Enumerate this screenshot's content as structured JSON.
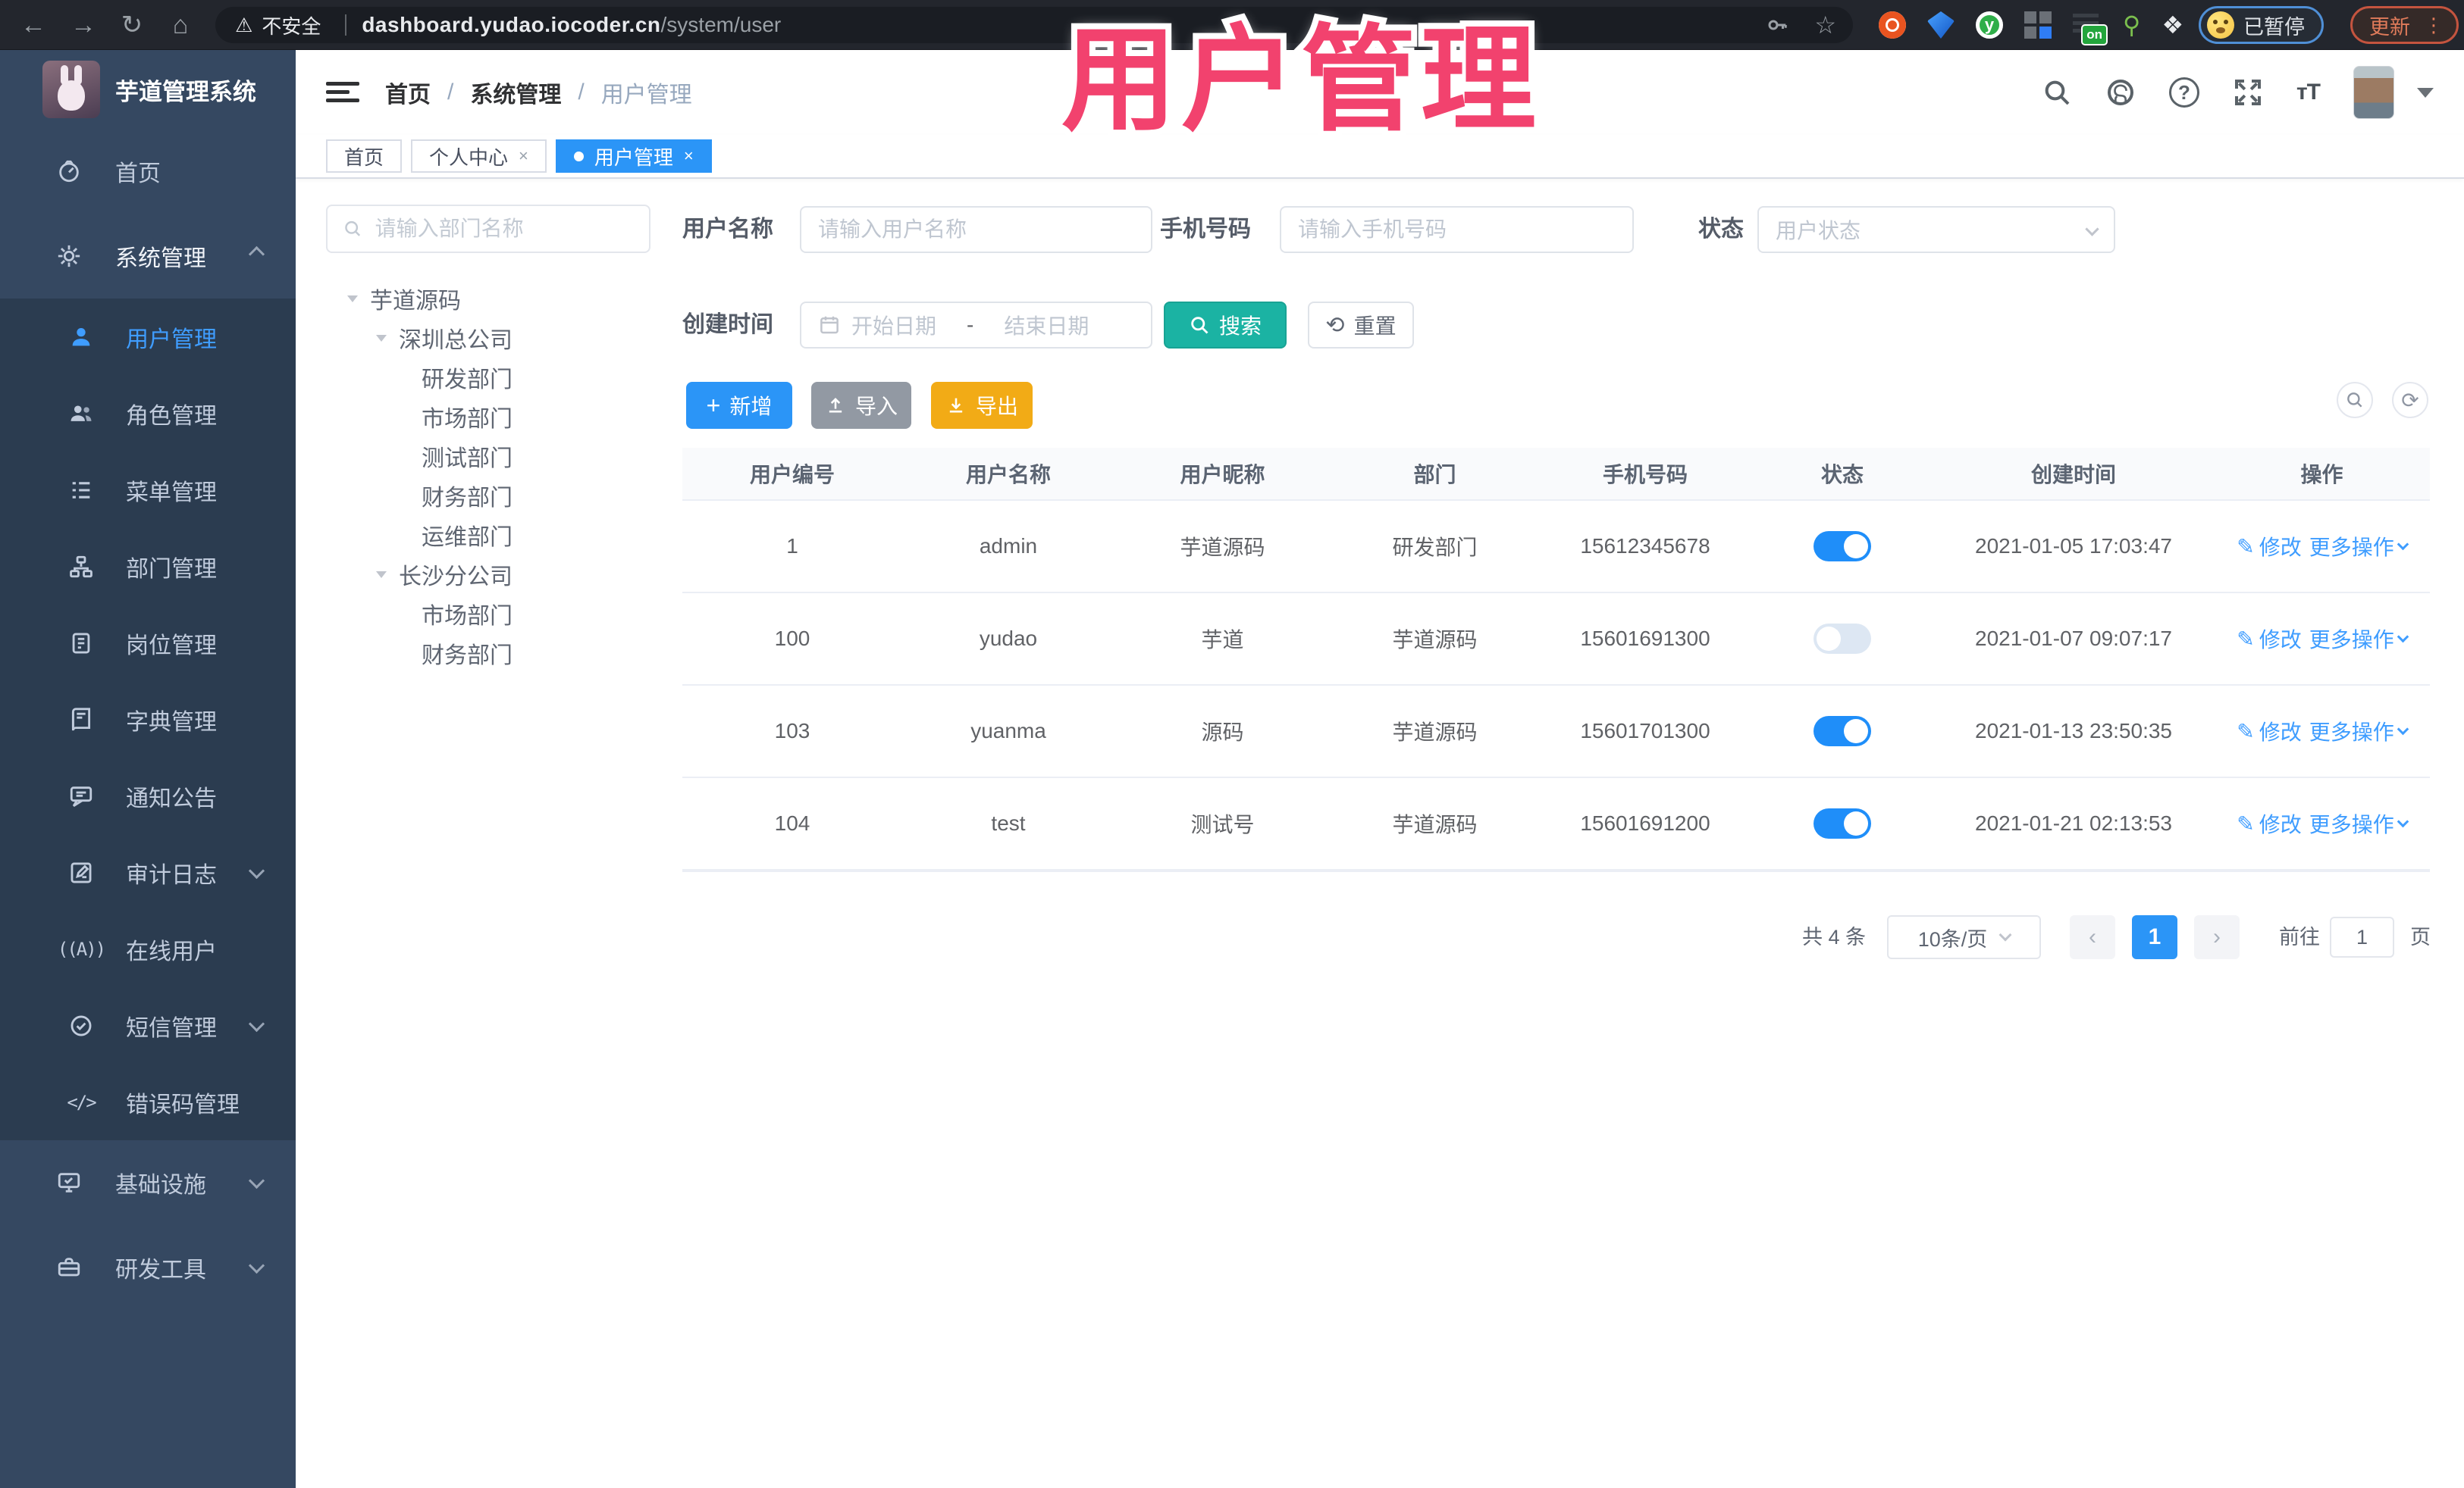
{
  "colors": {
    "accent": "#2b95f7",
    "teal_search": "#1bb3a3",
    "export_yellow": "#f2ab16",
    "import_gray": "#9299a3",
    "sidebar_bg": "#354861",
    "submenu_bg": "#2b3c50",
    "overlay_pink": "#f2426e",
    "toggle_on": "#1f8ef9"
  },
  "overlay_title": "用户管理",
  "browser": {
    "security_warning": "不安全",
    "url_host": "dashboard.yudao.iocoder.cn",
    "url_path": "/system/user",
    "ext_green_letter": "y",
    "ext_badge": "on",
    "profile_badge": "已暂停",
    "update_button": "更新",
    "menu_dots": "⋮"
  },
  "sidebar": {
    "app_title": "芋道管理系统",
    "items": [
      {
        "label": "首页"
      },
      {
        "label": "系统管理"
      },
      {
        "label": "用户管理"
      },
      {
        "label": "角色管理"
      },
      {
        "label": "菜单管理"
      },
      {
        "label": "部门管理"
      },
      {
        "label": "岗位管理"
      },
      {
        "label": "字典管理"
      },
      {
        "label": "通知公告"
      },
      {
        "label": "审计日志"
      },
      {
        "label": "在线用户"
      },
      {
        "label": "短信管理"
      },
      {
        "label": "错误码管理"
      },
      {
        "label": "基础设施"
      },
      {
        "label": "研发工具"
      }
    ]
  },
  "header": {
    "breadcrumb": [
      "首页",
      "系统管理",
      "用户管理"
    ],
    "separator": "/"
  },
  "tabs": [
    {
      "label": "首页"
    },
    {
      "label": "个人中心",
      "close": "×"
    },
    {
      "label": "用户管理",
      "close": "×"
    }
  ],
  "tree": {
    "search_placeholder": "请输入部门名称",
    "nodes": [
      {
        "label": "芋道源码"
      },
      {
        "label": "深圳总公司"
      },
      {
        "label": "研发部门"
      },
      {
        "label": "市场部门"
      },
      {
        "label": "测试部门"
      },
      {
        "label": "财务部门"
      },
      {
        "label": "运维部门"
      },
      {
        "label": "长沙分公司"
      },
      {
        "label": "市场部门"
      },
      {
        "label": "财务部门"
      }
    ]
  },
  "filters": {
    "username_label": "用户名称",
    "username_placeholder": "请输入用户名称",
    "mobile_label": "手机号码",
    "mobile_placeholder": "请输入手机号码",
    "status_label": "状态",
    "status_placeholder": "用户状态",
    "created_label": "创建时间",
    "date_start": "开始日期",
    "date_separator": "-",
    "date_end": "结束日期",
    "search_label": "搜索",
    "reset_label": "重置"
  },
  "toolbar": {
    "add_label": "新增",
    "import_label": "导入",
    "export_label": "导出"
  },
  "table": {
    "columns": [
      "用户编号",
      "用户名称",
      "用户昵称",
      "部门",
      "手机号码",
      "状态",
      "创建时间",
      "操作"
    ],
    "edit_label": "修改",
    "more_label": "更多操作",
    "rows": [
      {
        "id": "1",
        "username": "admin",
        "nickname": "芋道源码",
        "dept": "研发部门",
        "mobile": "15612345678",
        "status": "on",
        "created": "2021-01-05 17:03:47"
      },
      {
        "id": "100",
        "username": "yudao",
        "nickname": "芋道",
        "dept": "芋道源码",
        "mobile": "15601691300",
        "status": "off",
        "created": "2021-01-07 09:07:17"
      },
      {
        "id": "103",
        "username": "yuanma",
        "nickname": "源码",
        "dept": "芋道源码",
        "mobile": "15601701300",
        "status": "on",
        "created": "2021-01-13 23:50:35"
      },
      {
        "id": "104",
        "username": "test",
        "nickname": "测试号",
        "dept": "芋道源码",
        "mobile": "15601691200",
        "status": "on",
        "created": "2021-01-21 02:13:53"
      }
    ]
  },
  "pagination": {
    "total": "共 4 条",
    "page_size": "10条/页",
    "prev": "‹",
    "next": "›",
    "page": "1",
    "goto_label": "前往",
    "goto_value": "1",
    "page_unit": "页"
  }
}
